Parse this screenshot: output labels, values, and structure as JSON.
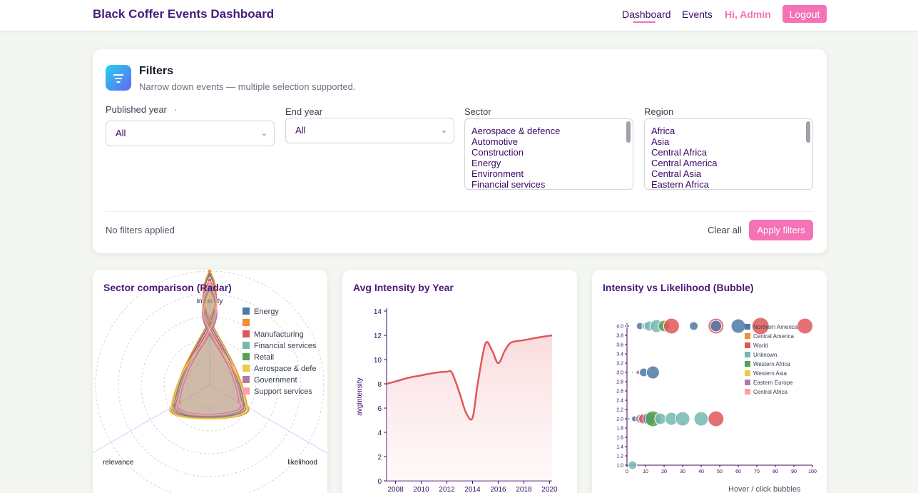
{
  "app": {
    "title": "Black Coffer Events Dashboard"
  },
  "nav": {
    "dashboard": "Dashboard",
    "events": "Events",
    "greeting": "Hi, Admin",
    "logout": "Logout"
  },
  "filters": {
    "title": "Filters",
    "subtitle": "Narrow down events — multiple selection supported.",
    "published_year": {
      "label": "Published year",
      "extra": "·",
      "value": "All"
    },
    "end_year": {
      "label": "End year",
      "value": "All"
    },
    "sector": {
      "label": "Sector",
      "options": [
        "Aerospace & defence",
        "Automotive",
        "Construction",
        "Energy",
        "Environment",
        "Financial services"
      ]
    },
    "region": {
      "label": "Region",
      "options": [
        "Africa",
        "Asia",
        "Central Africa",
        "Central America",
        "Central Asia",
        "Eastern Africa"
      ]
    },
    "status": "No filters applied",
    "clear_all": "Clear all",
    "apply": "Apply filters"
  },
  "charts": {
    "radar": {
      "title": "Sector comparison (Radar)",
      "axes": [
        "intensity",
        "relevance",
        "likelihood"
      ],
      "series": [
        {
          "name": "Energy",
          "color": "#4e79a7",
          "values": [
            0.97,
            0.35,
            0.36
          ]
        },
        {
          "name": "",
          "color": "#f28e2b",
          "values": [
            1.0,
            0.38,
            0.38
          ]
        },
        {
          "name": "Manufacturing",
          "color": "#e15759",
          "values": [
            0.92,
            0.33,
            0.34
          ]
        },
        {
          "name": "Financial services",
          "color": "#76b7b2",
          "values": [
            0.88,
            0.32,
            0.33
          ]
        },
        {
          "name": "Retail",
          "color": "#59a14f",
          "values": [
            0.85,
            0.31,
            0.32
          ]
        },
        {
          "name": "Aerospace & defe",
          "color": "#edc948",
          "values": [
            0.8,
            0.37,
            0.39
          ]
        },
        {
          "name": "Government",
          "color": "#b07aa1",
          "values": [
            0.84,
            0.3,
            0.31
          ]
        },
        {
          "name": "Support services",
          "color": "#ff9da7",
          "values": [
            0.9,
            0.31,
            0.32
          ]
        }
      ]
    },
    "line": {
      "title": "Avg Intensity by Year",
      "ylabel": "avgIntensity",
      "color": "#e15759",
      "yticks": [
        0,
        2,
        4,
        6,
        8,
        10,
        12,
        14
      ],
      "xticks": [
        2008,
        2010,
        2012,
        2014,
        2016,
        2018,
        2020
      ]
    },
    "bubble": {
      "title": "Intensity vs Likelihood (Bubble)",
      "note": "Hover / click bubbles",
      "yticks": [
        "1.0",
        "1.2",
        "1.4",
        "1.6",
        "1.8",
        "2.0",
        "2.2",
        "2.4",
        "2.6",
        "2.8",
        "3.0",
        "3.2",
        "3.4",
        "3.6",
        "3.8",
        "4.0"
      ],
      "xticks": [
        "0",
        "10",
        "20",
        "30",
        "40",
        "50",
        "60",
        "70",
        "80",
        "90",
        "100"
      ],
      "legend": [
        {
          "name": "Northern America",
          "color": "#4e79a7"
        },
        {
          "name": "Central America",
          "color": "#f28e2b"
        },
        {
          "name": "World",
          "color": "#e15759"
        },
        {
          "name": "Unknown",
          "color": "#76b7b2"
        },
        {
          "name": "Western Africa",
          "color": "#59a14f"
        },
        {
          "name": "Western Asia",
          "color": "#edc948"
        },
        {
          "name": "Eastern Europe",
          "color": "#b07aa1"
        },
        {
          "name": "Central Africa",
          "color": "#ff9da7"
        }
      ]
    }
  },
  "chart_data": [
    {
      "type": "line",
      "title": "Avg Intensity by Year",
      "ylabel": "avgIntensity",
      "ylim": [
        0,
        14
      ],
      "xlim": [
        2007.3,
        2020.2
      ],
      "x": [
        2007.3,
        2008,
        2009,
        2010,
        2011,
        2012,
        2012.4,
        2013,
        2013.5,
        2014,
        2014.4,
        2015,
        2015.5,
        2016,
        2016.5,
        2017,
        2018,
        2019,
        2020.2
      ],
      "y": [
        8.0,
        8.2,
        8.5,
        8.7,
        8.9,
        9.0,
        8.9,
        7.2,
        5.6,
        5.2,
        8.0,
        11.3,
        10.8,
        9.7,
        10.7,
        11.4,
        11.6,
        11.8,
        12.0
      ]
    },
    {
      "type": "scatter",
      "title": "Intensity vs Likelihood (Bubble)",
      "xlim": [
        0,
        100
      ],
      "ylim": [
        1.0,
        4.0
      ],
      "points": [
        {
          "x": 0.5,
          "y": 4.0,
          "r": 2,
          "color": "#4e79a7"
        },
        {
          "x": 7,
          "y": 4.0,
          "r": 5,
          "color": "#4e79a7"
        },
        {
          "x": 10,
          "y": 4.0,
          "r": 5,
          "color": "#76b7b2"
        },
        {
          "x": 12,
          "y": 4.0,
          "r": 7,
          "color": "#76b7b2"
        },
        {
          "x": 16,
          "y": 4.0,
          "r": 9,
          "color": "#76b7b2"
        },
        {
          "x": 20,
          "y": 4.0,
          "r": 8,
          "color": "#59a14f"
        },
        {
          "x": 24,
          "y": 4.0,
          "r": 11,
          "color": "#e15759"
        },
        {
          "x": 36,
          "y": 4.0,
          "r": 6,
          "color": "#4e79a7"
        },
        {
          "x": 48,
          "y": 4.0,
          "r": 11,
          "color": "#e15759"
        },
        {
          "x": 48,
          "y": 4.0,
          "r": 8,
          "color": "#4e79a7"
        },
        {
          "x": 60,
          "y": 4.0,
          "r": 10,
          "color": "#4e79a7"
        },
        {
          "x": 72,
          "y": 4.0,
          "r": 12,
          "color": "#e15759"
        },
        {
          "x": 96,
          "y": 4.0,
          "r": 11,
          "color": "#e15759"
        },
        {
          "x": 3,
          "y": 3.0,
          "r": 1.5,
          "color": "#76b7b2"
        },
        {
          "x": 6,
          "y": 3.0,
          "r": 3,
          "color": "#b07aa1"
        },
        {
          "x": 9,
          "y": 3.0,
          "r": 6,
          "color": "#4e79a7"
        },
        {
          "x": 14,
          "y": 3.0,
          "r": 9,
          "color": "#4e79a7"
        },
        {
          "x": 1,
          "y": 2.0,
          "r": 1.5,
          "color": "#4e79a7"
        },
        {
          "x": 4,
          "y": 2.0,
          "r": 4,
          "color": "#4e79a7"
        },
        {
          "x": 7,
          "y": 2.0,
          "r": 6,
          "color": "#b07aa1"
        },
        {
          "x": 9,
          "y": 2.0,
          "r": 7,
          "color": "#e15759"
        },
        {
          "x": 12,
          "y": 2.0,
          "r": 9,
          "color": "#4e79a7"
        },
        {
          "x": 14,
          "y": 2.0,
          "r": 11,
          "color": "#59a14f"
        },
        {
          "x": 18,
          "y": 2.0,
          "r": 8,
          "color": "#76b7b2"
        },
        {
          "x": 24,
          "y": 2.0,
          "r": 9,
          "color": "#76b7b2"
        },
        {
          "x": 30,
          "y": 2.0,
          "r": 10,
          "color": "#76b7b2"
        },
        {
          "x": 40,
          "y": 2.0,
          "r": 10,
          "color": "#76b7b2"
        },
        {
          "x": 48,
          "y": 2.0,
          "r": 11,
          "color": "#e15759"
        },
        {
          "x": 3,
          "y": 1.0,
          "r": 6,
          "color": "#76b7b2"
        }
      ]
    }
  ]
}
